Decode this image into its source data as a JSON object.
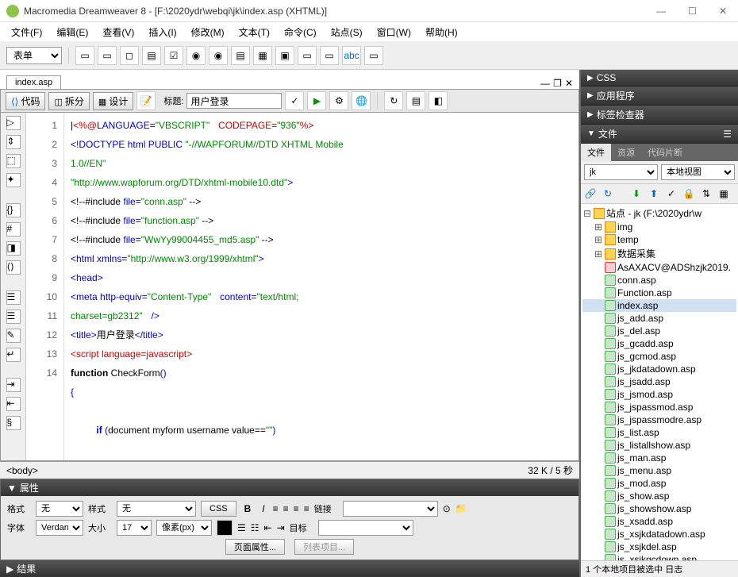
{
  "window": {
    "title": "Macromedia Dreamweaver 8 - [F:\\2020ydr\\webqi\\jk\\index.asp (XHTML)]"
  },
  "menu": [
    "文件(F)",
    "编辑(E)",
    "查看(V)",
    "插入(I)",
    "修改(M)",
    "文本(T)",
    "命令(C)",
    "站点(S)",
    "窗口(W)",
    "帮助(H)"
  ],
  "toolbar": {
    "form_label": "表单"
  },
  "doc": {
    "tab": "index.asp",
    "views": {
      "code": "代码",
      "split": "拆分",
      "design": "设计"
    },
    "title_label": "标题:",
    "title_value": "用户登录"
  },
  "code": {
    "lines": [
      1,
      2,
      3,
      4,
      5,
      6,
      7,
      8,
      9,
      10,
      11,
      12,
      13,
      14
    ]
  },
  "status": {
    "tag": "<body>",
    "info": "32 K / 5 秒"
  },
  "panels": {
    "props_title": "属性",
    "format_label": "格式",
    "format_value": "无",
    "style_label": "样式",
    "style_value": "无",
    "css_btn": "CSS",
    "link_label": "链接",
    "font_label": "字体",
    "font_value": "Verdana,",
    "size_label": "大小",
    "size_value": "17",
    "unit_value": "像素(px)",
    "target_label": "目标",
    "page_props_btn": "页面属性...",
    "list_items_btn": "列表项目...",
    "result_title": "结果"
  },
  "right": {
    "sections": [
      "CSS",
      "应用程序",
      "标签检查器",
      "文件"
    ],
    "tabs": [
      "文件",
      "资源",
      "代码片断"
    ],
    "site_dropdown": "jk",
    "view_dropdown": "本地视图",
    "tree_root": "站点 - jk (F:\\2020ydr\\w",
    "folders": [
      "img",
      "temp",
      "数据采集"
    ],
    "files": [
      {
        "name": "AsAXACV@ADShzjk2019.",
        "special": true
      },
      {
        "name": "conn.asp"
      },
      {
        "name": "Function.asp"
      },
      {
        "name": "index.asp",
        "selected": true
      },
      {
        "name": "js_add.asp"
      },
      {
        "name": "js_del.asp"
      },
      {
        "name": "js_gcadd.asp"
      },
      {
        "name": "js_gcmod.asp"
      },
      {
        "name": "js_jkdatadown.asp"
      },
      {
        "name": "js_jsadd.asp"
      },
      {
        "name": "js_jsmod.asp"
      },
      {
        "name": "js_jspassmod.asp"
      },
      {
        "name": "js_jspassmodre.asp"
      },
      {
        "name": "js_list.asp"
      },
      {
        "name": "js_listallshow.asp"
      },
      {
        "name": "js_man.asp"
      },
      {
        "name": "js_menu.asp"
      },
      {
        "name": "js_mod.asp"
      },
      {
        "name": "js_show.asp"
      },
      {
        "name": "js_showshow.asp"
      },
      {
        "name": "js_xsadd.asp"
      },
      {
        "name": "js_xsjkdatadown.asp"
      },
      {
        "name": "js_xsjkdel.asp"
      },
      {
        "name": "js_xsjkgcdown.asp"
      }
    ],
    "status": "1 个本地项目被选中  日志"
  }
}
